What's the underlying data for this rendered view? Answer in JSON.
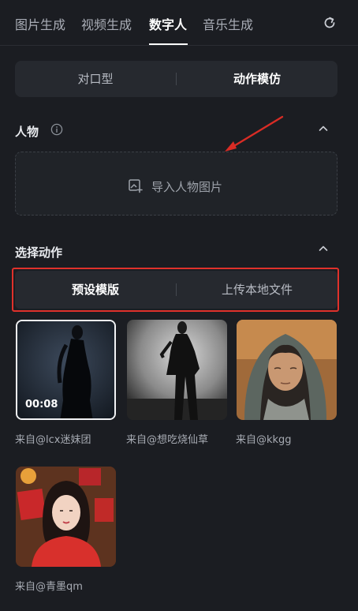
{
  "tabs": [
    {
      "label": "图片生成",
      "active": false
    },
    {
      "label": "视频生成",
      "active": false
    },
    {
      "label": "数字人",
      "active": true
    },
    {
      "label": "音乐生成",
      "active": false
    }
  ],
  "mode_switch": {
    "left": "对口型",
    "right": "动作模仿",
    "selected": "right"
  },
  "person_section": {
    "title": "人物",
    "upload_label": "导入人物图片"
  },
  "action_section": {
    "title": "选择动作",
    "switch": {
      "left": "预设模版",
      "right": "上传本地文件",
      "selected": "left"
    }
  },
  "templates": [
    {
      "caption": "来自@lcx迷妹团",
      "duration": "00:08",
      "selected": true
    },
    {
      "caption": "来自@想吃烧仙草",
      "duration": "",
      "selected": false
    },
    {
      "caption": "来自@kkgg",
      "duration": "",
      "selected": false
    },
    {
      "caption": "来自@青墨qm",
      "duration": "",
      "selected": false
    }
  ],
  "colors": {
    "background": "#1b1d22",
    "highlight_frame": "#e0312b",
    "annotation_arrow": "#d92c25"
  }
}
